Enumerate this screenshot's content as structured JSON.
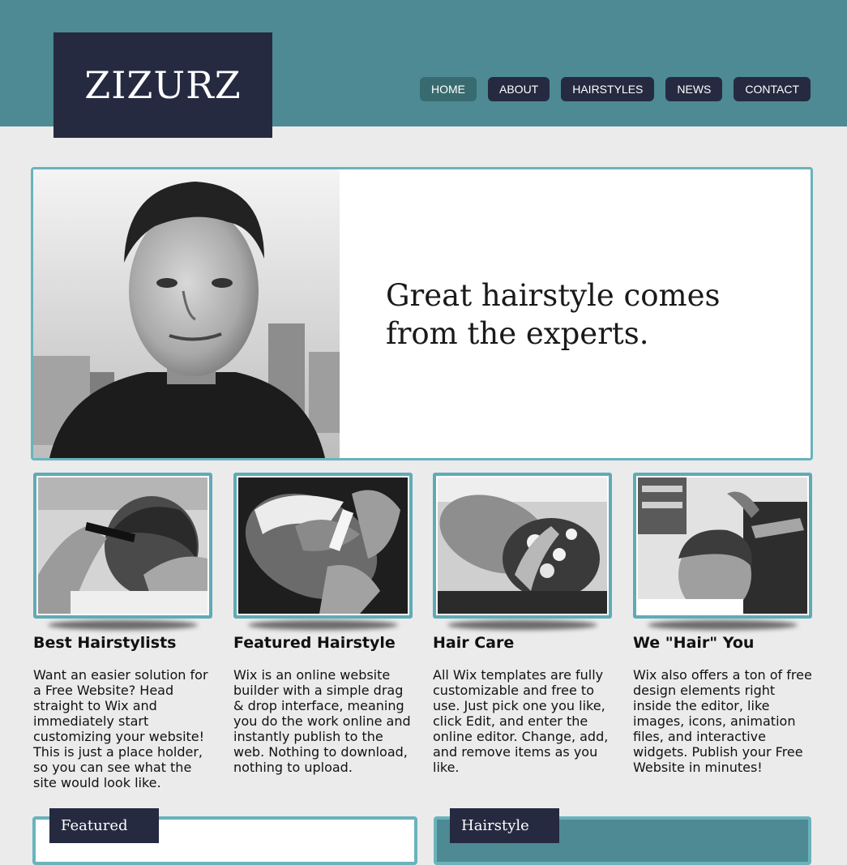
{
  "site": {
    "logo": "ZIZURZ"
  },
  "nav": {
    "items": [
      {
        "label": "HOME",
        "active": true
      },
      {
        "label": "ABOUT"
      },
      {
        "label": "HAIRSTYLES"
      },
      {
        "label": "NEWS"
      },
      {
        "label": "CONTACT"
      }
    ]
  },
  "hero": {
    "headline": "Great hairstyle comes from the experts."
  },
  "features": [
    {
      "title": "Best Hairstylists",
      "body": "Want an easier solution for a Free Website? Head straight to Wix and immediately start customizing your website! This is just a place holder, so you can see what the site would look like."
    },
    {
      "title": "Featured Hairstyle",
      "body": "Wix is an online website builder with a simple drag & drop interface, meaning you do the work online and instantly publish to the web. Nothing to download, nothing to upload."
    },
    {
      "title": "Hair Care",
      "body": "All Wix templates are fully customizable and free to use. Just pick one you like, click Edit, and enter the online editor. Change, add, and remove items as you like."
    },
    {
      "title": "We \"Hair\" You",
      "body": "Wix also offers a ton of free design elements right inside the editor, like images, icons, animation files, and interactive widgets. Publish your Free Website in minutes!"
    }
  ],
  "sections": {
    "featured_label": "Featured",
    "hairstyle_label": "Hairstyle"
  },
  "colors": {
    "header": "#4d8a93",
    "dark": "#262a40",
    "accent_border": "#6ab3bc",
    "nav_active": "#386b70",
    "page_bg": "#ebebeb"
  }
}
